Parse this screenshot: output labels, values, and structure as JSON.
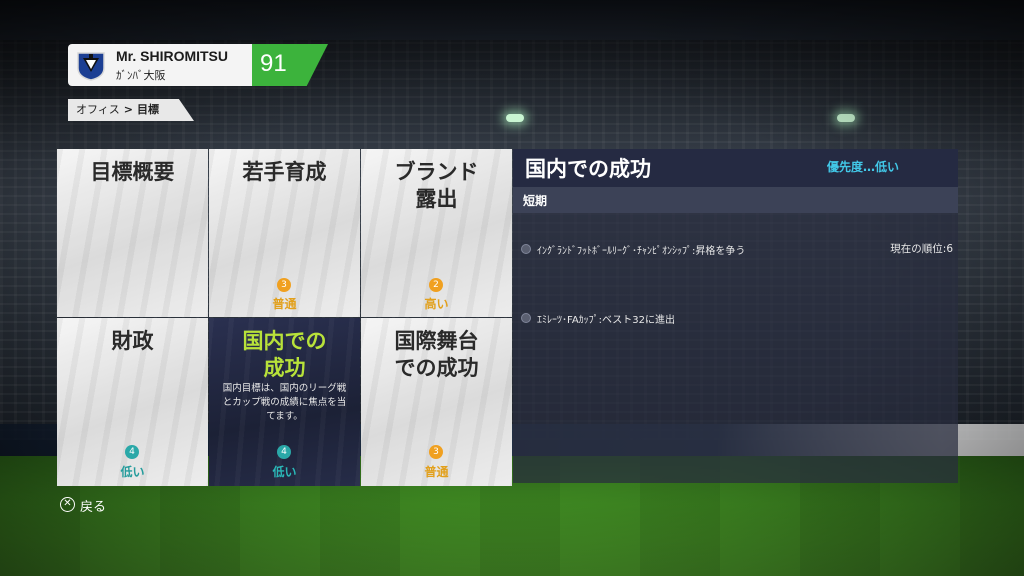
{
  "profile": {
    "manager_name": "Mr. SHIROMITSU",
    "club": "ｶﾞﾝﾊﾞ大阪",
    "rating": "91"
  },
  "breadcrumb": {
    "parent": "オフィス",
    "separator": ">",
    "current": "目標"
  },
  "tiles": [
    {
      "title_line1": "目標概要",
      "title_line2": "",
      "badge": "",
      "level": ""
    },
    {
      "title_line1": "若手育成",
      "title_line2": "",
      "badge": "3",
      "level": "普通",
      "badge_color": "#f0a020"
    },
    {
      "title_line1": "ブランド",
      "title_line2": "露出",
      "badge": "2",
      "level": "高い",
      "badge_color": "#f0a020"
    },
    {
      "title_line1": "財政",
      "title_line2": "",
      "badge": "4",
      "level": "低い",
      "badge_color": "#2aa8a8"
    },
    {
      "title_line1": "国内での",
      "title_line2": "成功",
      "badge": "4",
      "level": "低い",
      "badge_color": "#2aa8a8",
      "description": "国内目標は、国内のリーグ戦とカップ戦の成績に焦点を当てます。",
      "selected": true
    },
    {
      "title_line1": "国際舞台",
      "title_line2": "での成功",
      "badge": "3",
      "level": "普通",
      "badge_color": "#f0a020"
    }
  ],
  "panel": {
    "title": "国内での成功",
    "priority": "優先度…低い",
    "section": "短期",
    "objectives": [
      {
        "text": "ｲﾝｸﾞﾗﾝﾄﾞﾌｯﾄﾎﾞｰﾙﾘｰｸﾞ･ﾁｬﾝﾋﾟｵﾝｼｯﾌﾟ:昇格を争う",
        "status": "現在の順位:6"
      },
      {
        "text": "ｴﾐﾚｰﾂ･FAｶｯﾌﾟ:ベスト32に進出",
        "status": ""
      }
    ]
  },
  "footer": {
    "back_button": "✕",
    "back_label": "戻る"
  },
  "colors": {
    "accent_green": "#3cb33c",
    "selected_title": "#b8e23a",
    "priority_blue": "#42c8e8",
    "level_yellow": "#e2a01c",
    "level_teal": "#249c9c"
  }
}
